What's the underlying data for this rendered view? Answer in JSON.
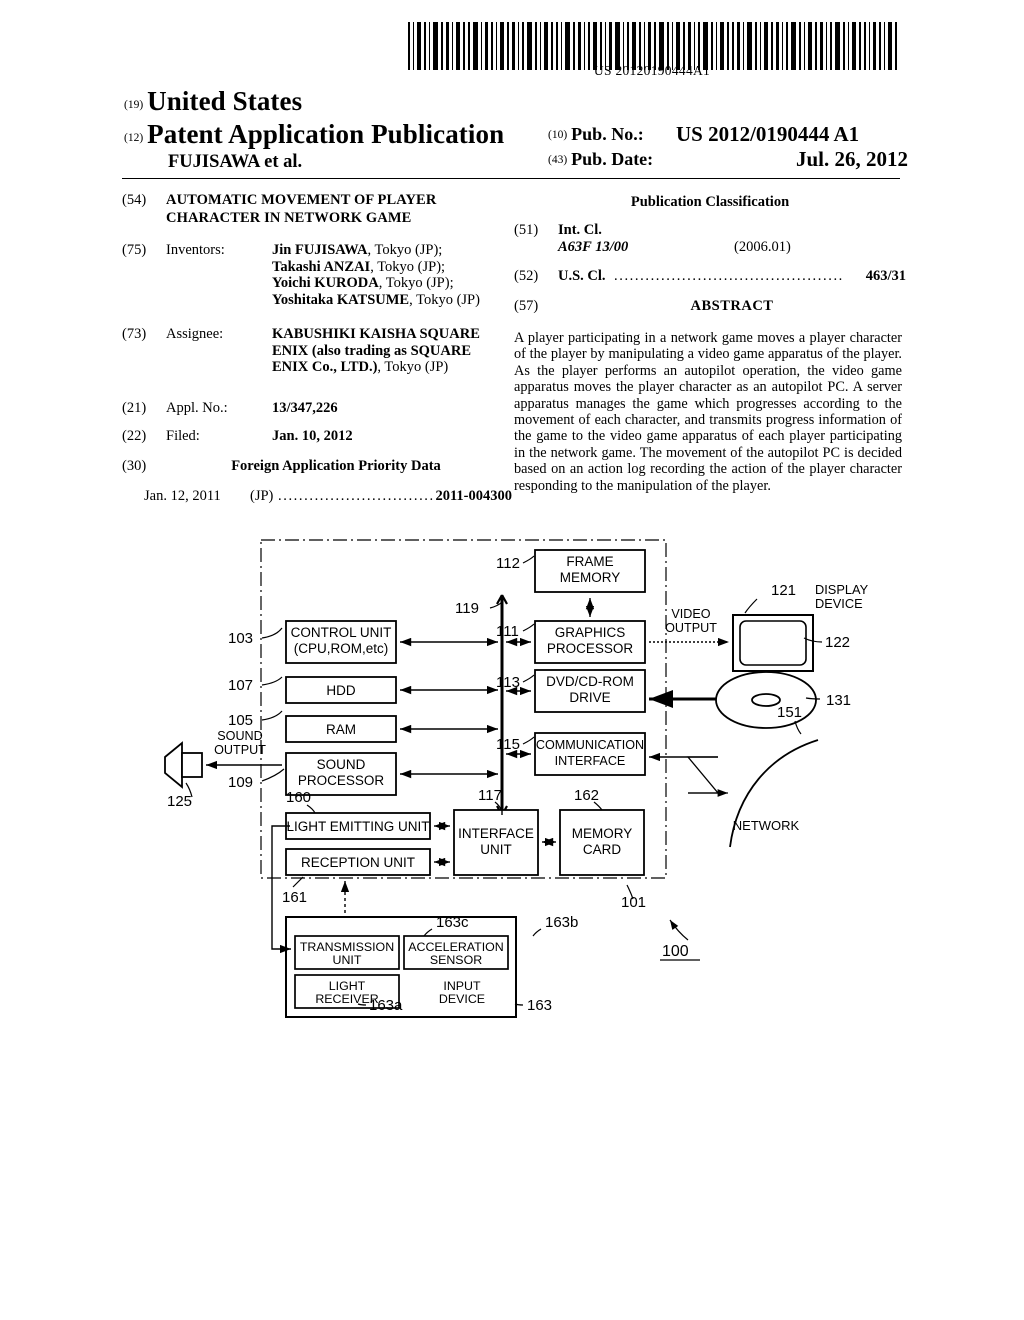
{
  "barcode": {
    "number": "US 20120190444A1"
  },
  "masthead": {
    "code_19": "(19)",
    "country": "United States",
    "code_12": "(12)",
    "doc_type": "Patent Application Publication",
    "applicant_line": "FUJISAWA et al.",
    "code_10": "(10)",
    "pub_no_label": "Pub. No.:",
    "pub_no_value": "US 2012/0190444 A1",
    "code_43": "(43)",
    "pub_date_label": "Pub. Date:",
    "pub_date_value": "Jul. 26, 2012"
  },
  "left_column": {
    "title_code": "(54)",
    "title_line1": "AUTOMATIC MOVEMENT OF PLAYER",
    "title_line2": "CHARACTER IN NETWORK GAME",
    "inventors_code": "(75)",
    "inventors_label": "Inventors:",
    "inventors": [
      "Jin FUJISAWA, Tokyo (JP);",
      "Takashi ANZAI, Tokyo (JP);",
      "Yoichi KURODA, Tokyo (JP);",
      "Yoshitaka KATSUME, Tokyo (JP)"
    ],
    "assignee_code": "(73)",
    "assignee_label": "Assignee:",
    "assignee_line1": "KABUSHIKI KAISHA SQUARE",
    "assignee_line2": "ENIX (also trading as SQUARE",
    "assignee_line3": "ENIX Co., LTD.), Tokyo (JP)",
    "appl_no_code": "(21)",
    "appl_no_label": "Appl. No.:",
    "appl_no_value": "13/347,226",
    "filed_code": "(22)",
    "filed_label": "Filed:",
    "filed_value": "Jan. 10, 2012",
    "foreign_code": "(30)",
    "foreign_header": "Foreign Application Priority Data",
    "foreign_date": "Jan. 12, 2011",
    "foreign_country": "(JP)",
    "foreign_dots": "...................................",
    "foreign_number": "2011-004300"
  },
  "right_column": {
    "pub_class_header": "Publication Classification",
    "intcl_code": "(51)",
    "intcl_label": "Int. Cl.",
    "intcl_class": "A63F  13/00",
    "intcl_year": "(2006.01)",
    "uscl_code": "(52)",
    "uscl_label": "U.S. Cl.",
    "uscl_dots": "..........................................................",
    "uscl_value": "463/31",
    "abstract_code": "(57)",
    "abstract_header": "ABSTRACT",
    "abstract_text": "A player participating in a network game moves a player character of the player by manipulating a video game apparatus of the player. As the player performs an autopilot operation, the video game apparatus moves the player character as an autopilot PC. A server apparatus manages the game which progresses according to the movement of each character, and transmits progress information of the game to the video game apparatus of each player participating in the network game. The movement of the autopilot PC is decided based on an action log recording the action of the player character responding to the manipulation of the player."
  },
  "figure": {
    "blocks": {
      "frame_memory_l1": "FRAME",
      "frame_memory_l2": "MEMORY",
      "control_unit_l1": "CONTROL UNIT",
      "control_unit_l2": "(CPU,ROM,etc)",
      "graphics_processor_l1": "GRAPHICS",
      "graphics_processor_l2": "PROCESSOR",
      "hdd": "HDD",
      "dvd_l1": "DVD/CD-ROM",
      "dvd_l2": "DRIVE",
      "ram": "RAM",
      "sound_processor_l1": "SOUND",
      "sound_processor_l2": "PROCESSOR",
      "comm_interface_l1": "COMMUNICATION",
      "comm_interface_l2": "INTERFACE",
      "light_emitting_unit": "LIGHT EMITTING UNIT",
      "reception_unit": "RECEPTION UNIT",
      "interface_unit_l1": "INTERFACE",
      "interface_unit_l2": "UNIT",
      "memory_card_l1": "MEMORY",
      "memory_card_l2": "CARD",
      "transmission_unit_l1": "TRANSMISSION",
      "transmission_unit_l2": "UNIT",
      "acceleration_sensor_l1": "ACCELERATION",
      "acceleration_sensor_l2": "SENSOR",
      "light_receiver_l1": "LIGHT",
      "light_receiver_l2": "RECEIVER",
      "input_device_l1": "INPUT",
      "input_device_l2": "DEVICE"
    },
    "labels": {
      "sound_output_l1": "SOUND",
      "sound_output_l2": "OUTPUT",
      "video_output_l1": "VIDEO",
      "video_output_l2": "OUTPUT",
      "display_device_l1": "DISPLAY",
      "display_device_l2": "DEVICE",
      "network": "NETWORK"
    },
    "refs": {
      "r100": "100",
      "r101": "101",
      "r103": "103",
      "r105": "105",
      "r107": "107",
      "r109": "109",
      "r111": "111",
      "r112": "112",
      "r113": "113",
      "r115": "115",
      "r117": "117",
      "r119": "119",
      "r121": "121",
      "r122": "122",
      "r125": "125",
      "r131": "131",
      "r151": "151",
      "r160": "160",
      "r161": "161",
      "r162": "162",
      "r163": "163",
      "r163a": "163a",
      "r163b": "163b",
      "r163c": "163c"
    }
  }
}
